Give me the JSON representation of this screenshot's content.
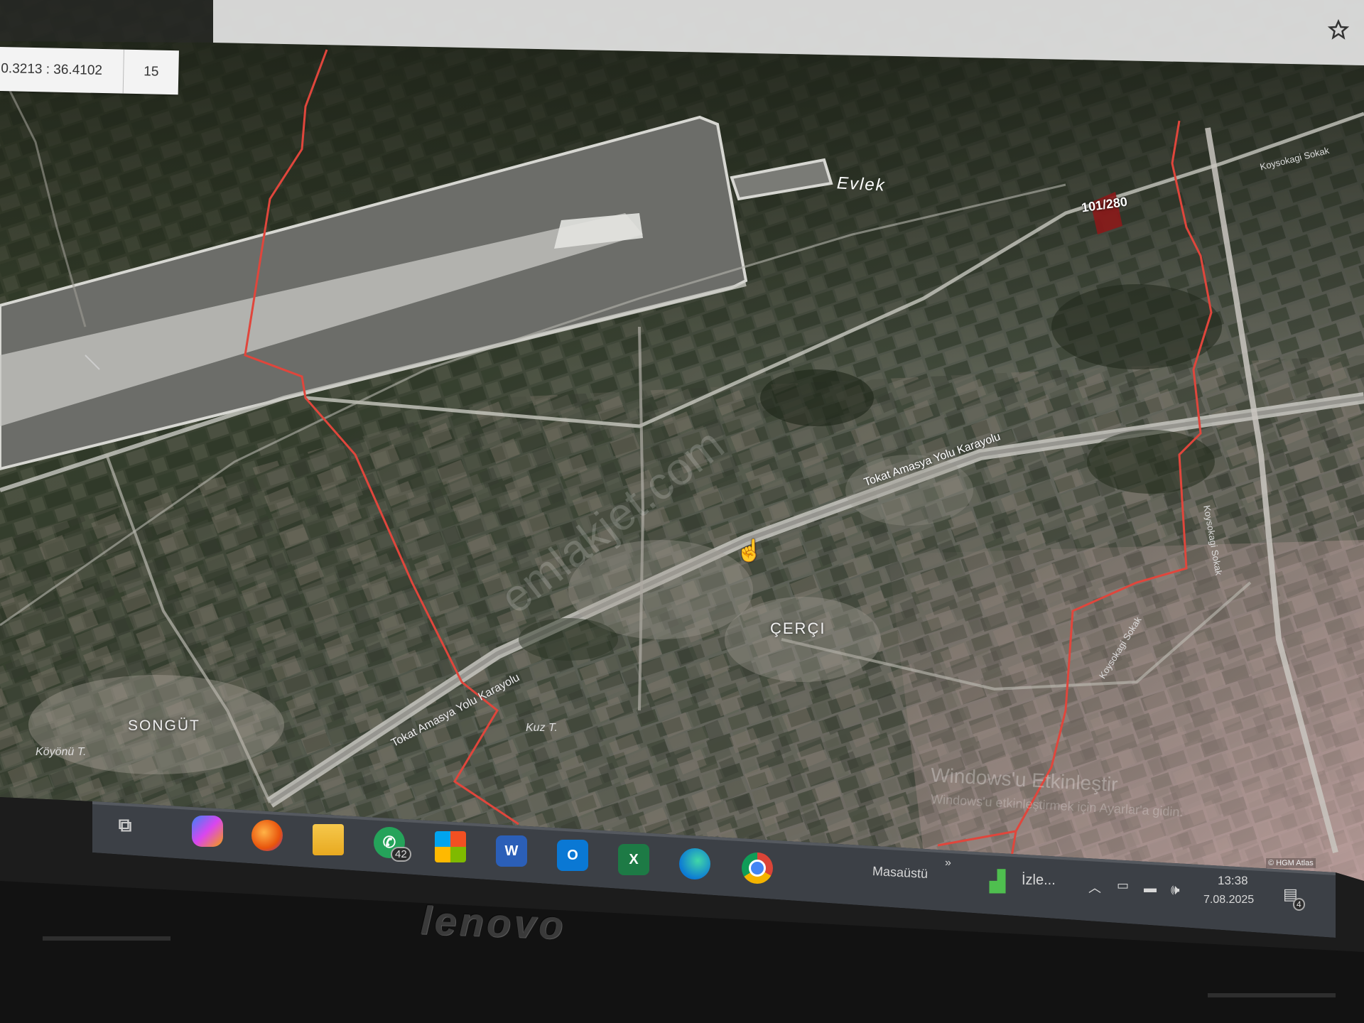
{
  "coord_readout": {
    "coordinates": "0.3213 : 36.4102",
    "zoom": "15"
  },
  "map_labels": {
    "village_top": "Evlek",
    "parcel": "101/280",
    "road_upper": "Tokat Amasya Yolu Karayolu",
    "road_lower": "Tokat Amasya Yolu Karayolu",
    "village_center": "ÇERÇI",
    "village_left": "SONGÜT",
    "hill_left": "Köyönü T.",
    "hill_center": "Kuz T.",
    "street_right_top": "Koysokagi Sokak",
    "street_right_vertical": "Koysokagi Sokak",
    "street_right_mid": "Koysokagi Sokak",
    "watermark": "emlakjet.com",
    "windows_activation_1": "Windows'u Etkinleştir",
    "windows_activation_2": "Windows'u etkinleştirmek için Ayarlar'a gidin.",
    "map_credit": "© HGM Atlas"
  },
  "taskbar": {
    "whatsapp_badge": "42",
    "desktop_label": "Masaüstü",
    "chevron": "»",
    "widget_label": "İzle...",
    "time": "13:38",
    "date": "7.08.2025",
    "notification_count": "4"
  },
  "laptop_brand": "lenovo",
  "browser": {
    "bookmark_icon": "star-icon"
  },
  "colors": {
    "parcel_boundary": "#e0463c",
    "parcel_label_fill": "#8b1a1a",
    "taskbar_bg": "#3c4046",
    "screen_bezel": "#1c1c1c"
  }
}
